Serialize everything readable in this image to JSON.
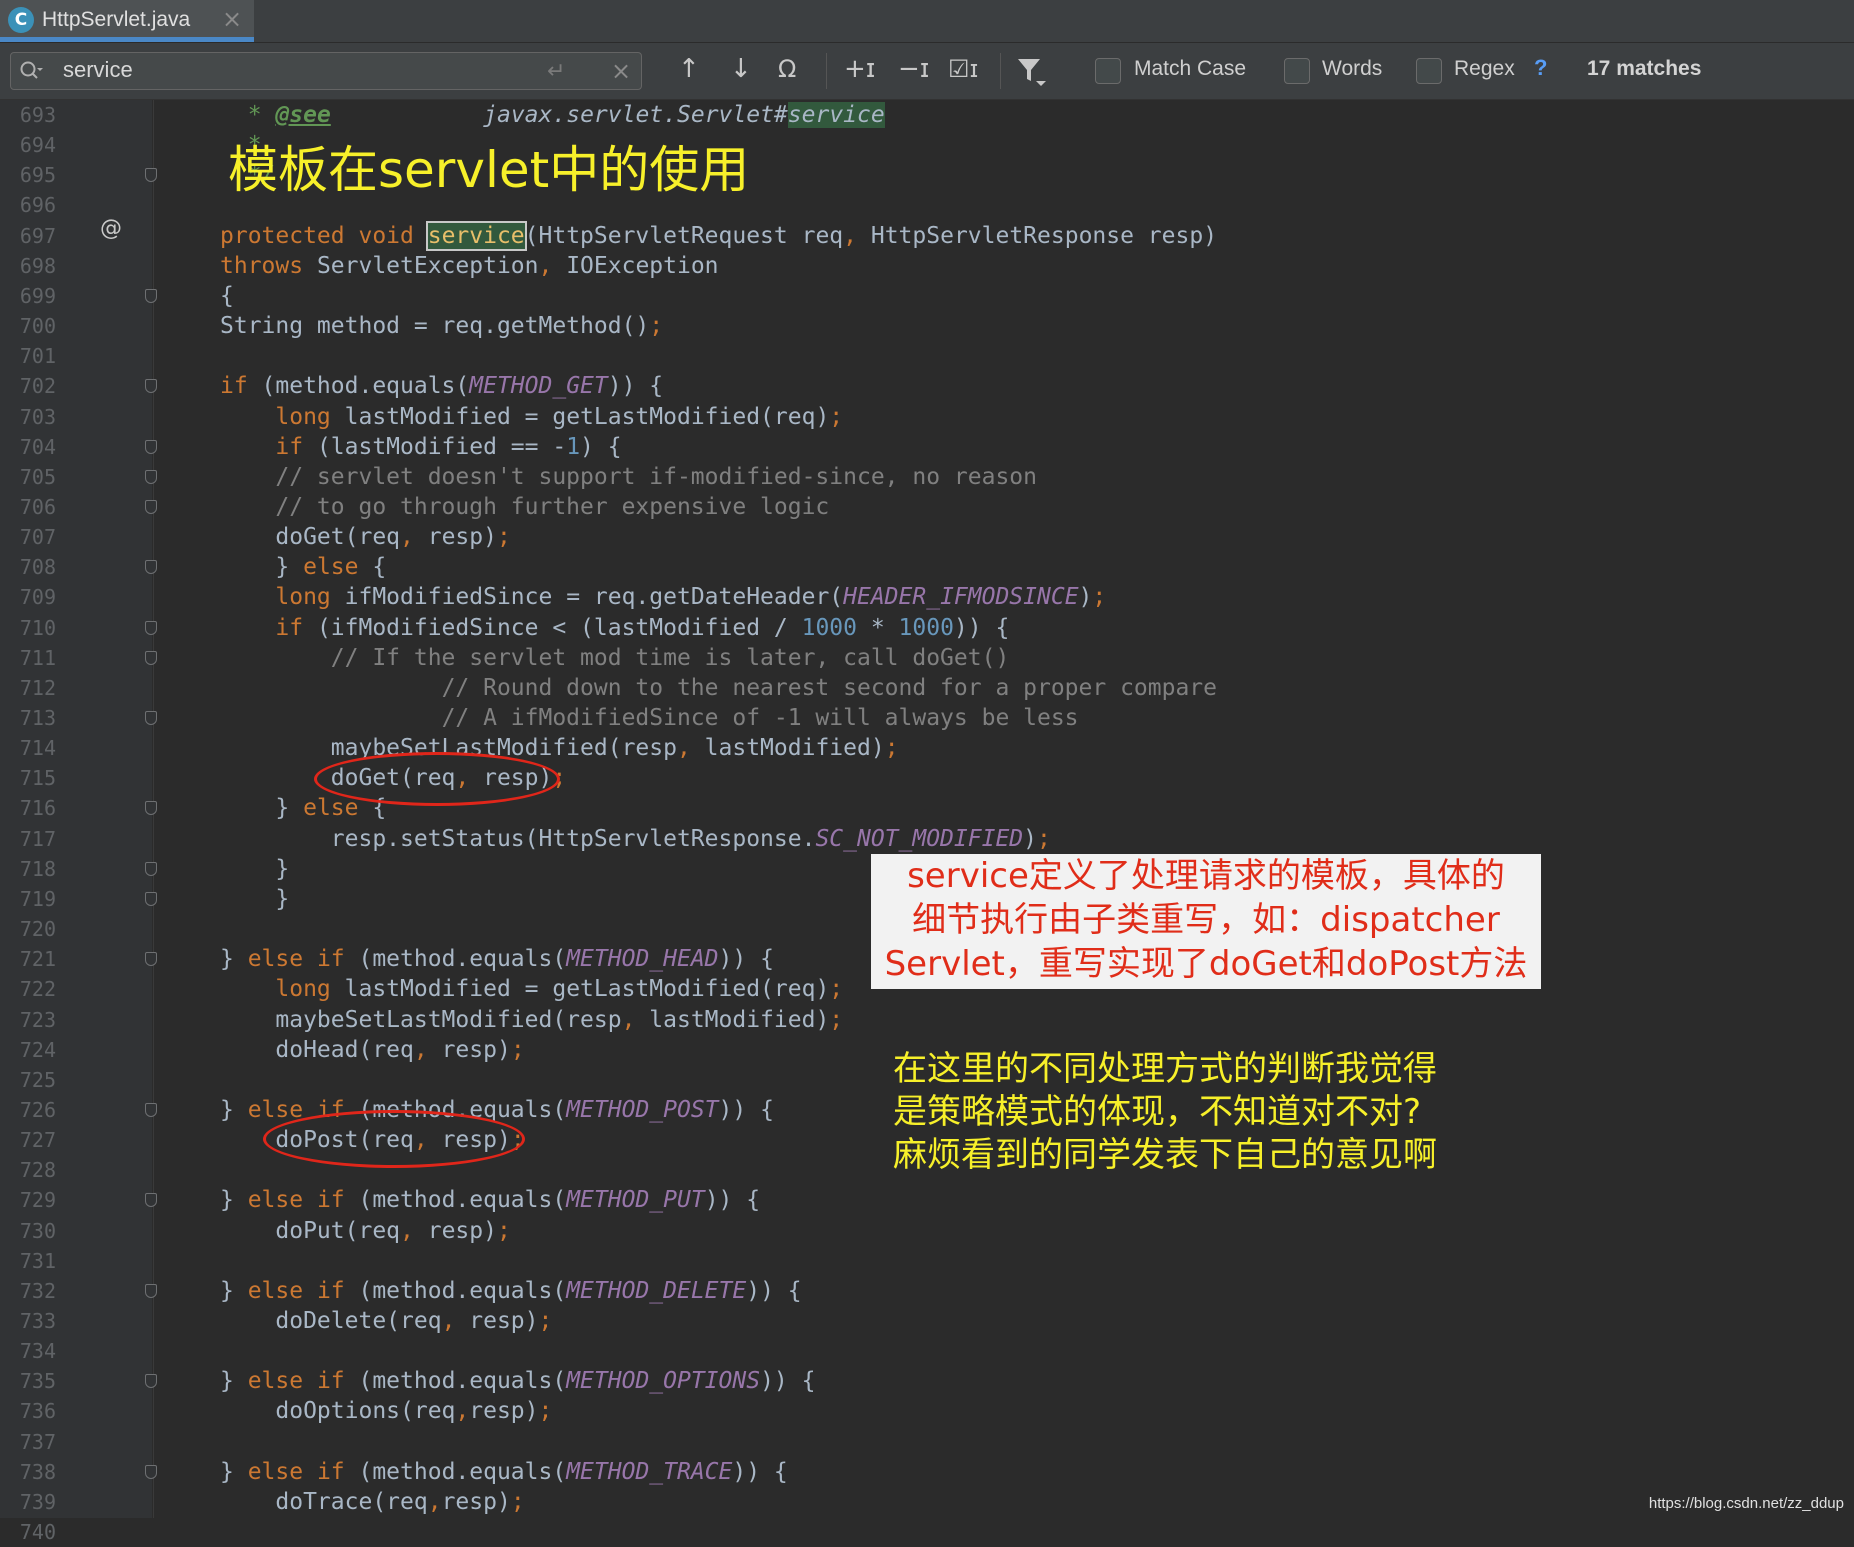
{
  "tab": {
    "icon_letter": "C",
    "file_name": "HttpServlet.java"
  },
  "find": {
    "query": "service",
    "options": {
      "match_case": "Match Case",
      "words": "Words",
      "regex": "Regex",
      "help": "?"
    },
    "matches": "17 matches"
  },
  "annotations": {
    "title": "模板在servlet中的使用",
    "red_note": [
      "service定义了处理请求的模板，具体的",
      "细节执行由子类重写，如：dispatcher",
      "Servlet，重写实现了doGet和doPost方法"
    ],
    "yellow_note": [
      "在这里的不同处理方式的判断我觉得",
      "是策略模式的体现，不知道对不对?",
      "麻烦看到的同学发表下自己的意见啊"
    ],
    "watermark": "https://blog.csdn.net/zz_ddup"
  },
  "gutter_marker": "@",
  "editor": {
    "lines": [
      {
        "n": "693",
        "t": [
          [
            "  ",
            ""
          ],
          [
            "*",
            "doc"
          ],
          [
            " ",
            ""
          ],
          [
            "@see",
            "doctag"
          ],
          [
            "           ",
            ""
          ],
          [
            "javax.servlet.Servlet#",
            "docref"
          ],
          [
            "service",
            "hl docref"
          ]
        ]
      },
      {
        "n": "694",
        "t": [
          [
            "  ",
            ""
          ],
          [
            "*",
            "doc"
          ]
        ]
      },
      {
        "n": "695",
        "t": [
          [
            "  ",
            ""
          ],
          [
            "*/",
            "doc"
          ]
        ]
      },
      {
        "n": "696",
        "t": []
      },
      {
        "n": "697",
        "t": [
          [
            "protected void ",
            "k"
          ],
          [
            "service",
            "hl-sel"
          ],
          [
            "(HttpServletRequest req",
            ""
          ],
          [
            ", ",
            "p"
          ],
          [
            "HttpServletResponse resp)",
            ""
          ]
        ]
      },
      {
        "n": "698",
        "t": [
          [
            "throws ",
            "k"
          ],
          [
            "ServletException",
            ""
          ],
          [
            ", ",
            "p"
          ],
          [
            "IOException",
            ""
          ]
        ]
      },
      {
        "n": "699",
        "t": [
          [
            "{",
            ""
          ]
        ]
      },
      {
        "n": "700",
        "t": [
          [
            "String method = req.getMethod()",
            ""
          ],
          [
            ";",
            "p"
          ]
        ]
      },
      {
        "n": "701",
        "t": []
      },
      {
        "n": "702",
        "t": [
          [
            "if ",
            "k"
          ],
          [
            "(method.equals(",
            ""
          ],
          [
            "METHOD_GET",
            "cst"
          ],
          [
            ")) {",
            ""
          ]
        ]
      },
      {
        "n": "703",
        "t": [
          [
            "    ",
            ""
          ],
          [
            "long ",
            "k"
          ],
          [
            "lastModified = getLastModified(req)",
            ""
          ],
          [
            ";",
            "p"
          ]
        ]
      },
      {
        "n": "704",
        "t": [
          [
            "    ",
            ""
          ],
          [
            "if ",
            "k"
          ],
          [
            "(lastModified == -",
            ""
          ],
          [
            "1",
            "n"
          ],
          [
            ") {",
            ""
          ]
        ]
      },
      {
        "n": "705",
        "t": [
          [
            "    ",
            ""
          ],
          [
            "// servlet doesn't support if-modified-since, no reason",
            "c"
          ]
        ]
      },
      {
        "n": "706",
        "t": [
          [
            "    ",
            ""
          ],
          [
            "// to go through further expensive logic",
            "c"
          ]
        ]
      },
      {
        "n": "707",
        "t": [
          [
            "    doGet(req",
            ""
          ],
          [
            ", ",
            "p"
          ],
          [
            "resp)",
            ""
          ],
          [
            ";",
            "p"
          ]
        ]
      },
      {
        "n": "708",
        "t": [
          [
            "    } ",
            ""
          ],
          [
            "else ",
            "k"
          ],
          [
            "{",
            ""
          ]
        ]
      },
      {
        "n": "709",
        "t": [
          [
            "    ",
            ""
          ],
          [
            "long ",
            "k"
          ],
          [
            "ifModifiedSince = req.getDateHeader(",
            ""
          ],
          [
            "HEADER_IFMODSINCE",
            "cst"
          ],
          [
            ")",
            ""
          ],
          [
            ";",
            "p"
          ]
        ]
      },
      {
        "n": "710",
        "t": [
          [
            "    ",
            ""
          ],
          [
            "if ",
            "k"
          ],
          [
            "(ifModifiedSince < (lastModified / ",
            ""
          ],
          [
            "1000",
            "n"
          ],
          [
            " * ",
            ""
          ],
          [
            "1000",
            "n"
          ],
          [
            ")) {",
            ""
          ]
        ]
      },
      {
        "n": "711",
        "t": [
          [
            "        ",
            ""
          ],
          [
            "// If the servlet mod time is later, call doGet()",
            "c"
          ]
        ]
      },
      {
        "n": "712",
        "t": [
          [
            "                ",
            ""
          ],
          [
            "// Round down to the nearest second for a proper compare",
            "c"
          ]
        ]
      },
      {
        "n": "713",
        "t": [
          [
            "                ",
            ""
          ],
          [
            "// A ifModifiedSince of -1 will always be less",
            "c"
          ]
        ]
      },
      {
        "n": "714",
        "t": [
          [
            "        maybeSetLastModified(resp",
            ""
          ],
          [
            ", ",
            "p"
          ],
          [
            "lastModified)",
            ""
          ],
          [
            ";",
            "p"
          ]
        ]
      },
      {
        "n": "715",
        "t": [
          [
            "        doGet(req",
            ""
          ],
          [
            ", ",
            "p"
          ],
          [
            "resp)",
            ""
          ],
          [
            ";",
            "p"
          ]
        ]
      },
      {
        "n": "716",
        "t": [
          [
            "    } ",
            ""
          ],
          [
            "else ",
            "k"
          ],
          [
            "{",
            ""
          ]
        ]
      },
      {
        "n": "717",
        "t": [
          [
            "        resp.setStatus(HttpServletResponse.",
            ""
          ],
          [
            "SC_NOT_MODIFIED",
            "cst"
          ],
          [
            ")",
            ""
          ],
          [
            ";",
            "p"
          ]
        ]
      },
      {
        "n": "718",
        "t": [
          [
            "    }",
            ""
          ]
        ]
      },
      {
        "n": "719",
        "t": [
          [
            "    }",
            ""
          ]
        ]
      },
      {
        "n": "720",
        "t": []
      },
      {
        "n": "721",
        "t": [
          [
            "} ",
            ""
          ],
          [
            "else if ",
            "k"
          ],
          [
            "(method.equals(",
            ""
          ],
          [
            "METHOD_HEAD",
            "cst"
          ],
          [
            ")) {",
            ""
          ]
        ]
      },
      {
        "n": "722",
        "t": [
          [
            "    ",
            ""
          ],
          [
            "long ",
            "k"
          ],
          [
            "lastModified = getLastModified(req)",
            ""
          ],
          [
            ";",
            "p"
          ]
        ]
      },
      {
        "n": "723",
        "t": [
          [
            "    maybeSetLastModified(resp",
            ""
          ],
          [
            ", ",
            "p"
          ],
          [
            "lastModified)",
            ""
          ],
          [
            ";",
            "p"
          ]
        ]
      },
      {
        "n": "724",
        "t": [
          [
            "    doHead(req",
            ""
          ],
          [
            ", ",
            "p"
          ],
          [
            "resp)",
            ""
          ],
          [
            ";",
            "p"
          ]
        ]
      },
      {
        "n": "725",
        "t": []
      },
      {
        "n": "726",
        "t": [
          [
            "} ",
            ""
          ],
          [
            "else if ",
            "k"
          ],
          [
            "(method.equals(",
            ""
          ],
          [
            "METHOD_POST",
            "cst"
          ],
          [
            ")) {",
            ""
          ]
        ]
      },
      {
        "n": "727",
        "t": [
          [
            "    doPost(req",
            ""
          ],
          [
            ", ",
            "p"
          ],
          [
            "resp)",
            ""
          ],
          [
            ";",
            "p"
          ]
        ]
      },
      {
        "n": "728",
        "t": []
      },
      {
        "n": "729",
        "t": [
          [
            "} ",
            ""
          ],
          [
            "else if ",
            "k"
          ],
          [
            "(method.equals(",
            ""
          ],
          [
            "METHOD_PUT",
            "cst"
          ],
          [
            ")) {",
            ""
          ]
        ]
      },
      {
        "n": "730",
        "t": [
          [
            "    doPut(req",
            ""
          ],
          [
            ", ",
            "p"
          ],
          [
            "resp)",
            ""
          ],
          [
            ";",
            "p"
          ]
        ]
      },
      {
        "n": "731",
        "t": []
      },
      {
        "n": "732",
        "t": [
          [
            "} ",
            ""
          ],
          [
            "else if ",
            "k"
          ],
          [
            "(method.equals(",
            ""
          ],
          [
            "METHOD_DELETE",
            "cst"
          ],
          [
            ")) {",
            ""
          ]
        ]
      },
      {
        "n": "733",
        "t": [
          [
            "    doDelete(req",
            ""
          ],
          [
            ", ",
            "p"
          ],
          [
            "resp)",
            ""
          ],
          [
            ";",
            "p"
          ]
        ]
      },
      {
        "n": "734",
        "t": []
      },
      {
        "n": "735",
        "t": [
          [
            "} ",
            ""
          ],
          [
            "else if ",
            "k"
          ],
          [
            "(method.equals(",
            ""
          ],
          [
            "METHOD_OPTIONS",
            "cst"
          ],
          [
            ")) {",
            ""
          ]
        ]
      },
      {
        "n": "736",
        "t": [
          [
            "    doOptions(req",
            ""
          ],
          [
            ",",
            "p"
          ],
          [
            "resp)",
            ""
          ],
          [
            ";",
            "p"
          ]
        ]
      },
      {
        "n": "737",
        "t": []
      },
      {
        "n": "738",
        "t": [
          [
            "} ",
            ""
          ],
          [
            "else if ",
            "k"
          ],
          [
            "(method.equals(",
            ""
          ],
          [
            "METHOD_TRACE",
            "cst"
          ],
          [
            ")) {",
            ""
          ]
        ]
      },
      {
        "n": "739",
        "t": [
          [
            "    doTrace(req",
            ""
          ],
          [
            ",",
            "p"
          ],
          [
            "resp)",
            ""
          ],
          [
            ";",
            "p"
          ]
        ]
      },
      {
        "n": "740",
        "t": []
      }
    ],
    "fold_lines": [
      "695",
      "699",
      "702",
      "704",
      "705",
      "706",
      "708",
      "710",
      "711",
      "713",
      "716",
      "718",
      "719",
      "721",
      "726",
      "729",
      "732",
      "735",
      "738"
    ]
  }
}
